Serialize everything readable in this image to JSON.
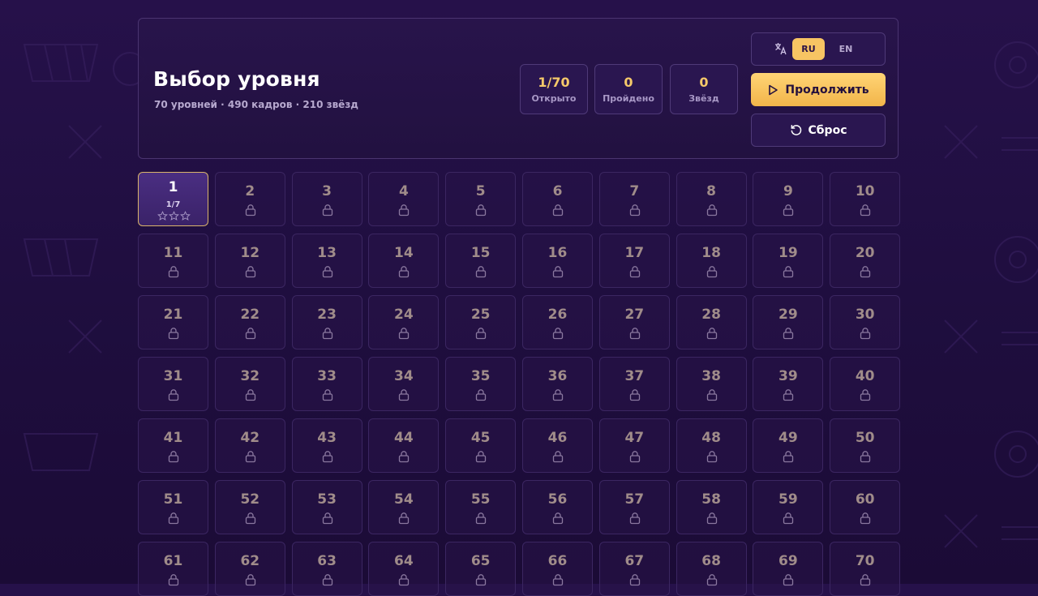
{
  "header": {
    "title": "Выбор уровня",
    "subtitle": "70 уровней · 490 кадров · 210 звёзд"
  },
  "stats": [
    {
      "value": "1/70",
      "label": "Открыто"
    },
    {
      "value": "0",
      "label": "Пройдено"
    },
    {
      "value": "0",
      "label": "Звёзд"
    }
  ],
  "language": {
    "icon": "translate-icon",
    "options": [
      "RU",
      "EN"
    ],
    "selected": "RU"
  },
  "buttons": {
    "continue_label": "Продолжить",
    "continue_icon": "play-icon",
    "reset_label": "Сброс",
    "reset_icon": "reset-icon"
  },
  "levels": {
    "total": 70,
    "unlocked": [
      {
        "number": "1",
        "progress": "1/7",
        "stars": 0,
        "max_stars": 3
      }
    ],
    "locked_icon": "lock-icon"
  },
  "colors": {
    "accent": "#f7c463",
    "background": "#22103f",
    "locked_number": "#a08c8a",
    "unlocked_border": "#d9b46a"
  }
}
